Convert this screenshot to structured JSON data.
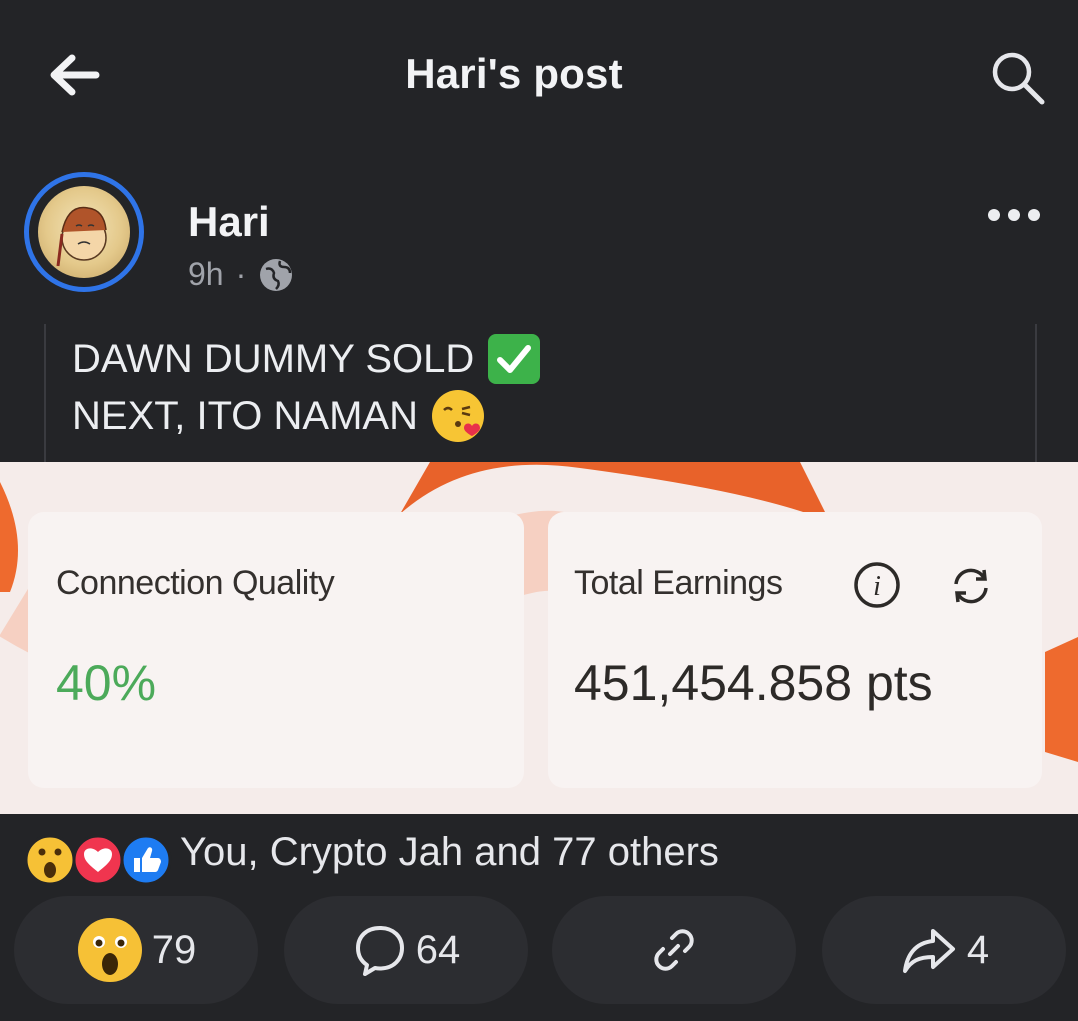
{
  "header": {
    "title": "Hari's post"
  },
  "post": {
    "author": "Hari",
    "time": "9h",
    "separator": "·",
    "caption_line1": "DAWN DUMMY SOLD",
    "caption_line2": "NEXT, ITO NAMAN"
  },
  "screenshot": {
    "connection_label": "Connection Quality",
    "connection_value": "40%",
    "earnings_label": "Total Earnings",
    "earnings_value": "451,454.858 pts"
  },
  "reactions": {
    "summary": "You, Crypto Jah and 77 others"
  },
  "actions": {
    "reaction_count": "79",
    "comment_count": "64",
    "share_count": "4"
  },
  "colors": {
    "background": "#232427",
    "accent": "#2f74e8",
    "green": "#4caa5a",
    "orange": "#f07a3a"
  },
  "icons": [
    "back-arrow-icon",
    "search-icon",
    "globe-icon",
    "more-icon",
    "check-emoji-icon",
    "kiss-emoji-icon",
    "info-icon",
    "refresh-icon",
    "wow-reaction-icon",
    "love-reaction-icon",
    "like-reaction-icon",
    "comment-icon",
    "link-icon",
    "share-icon"
  ]
}
